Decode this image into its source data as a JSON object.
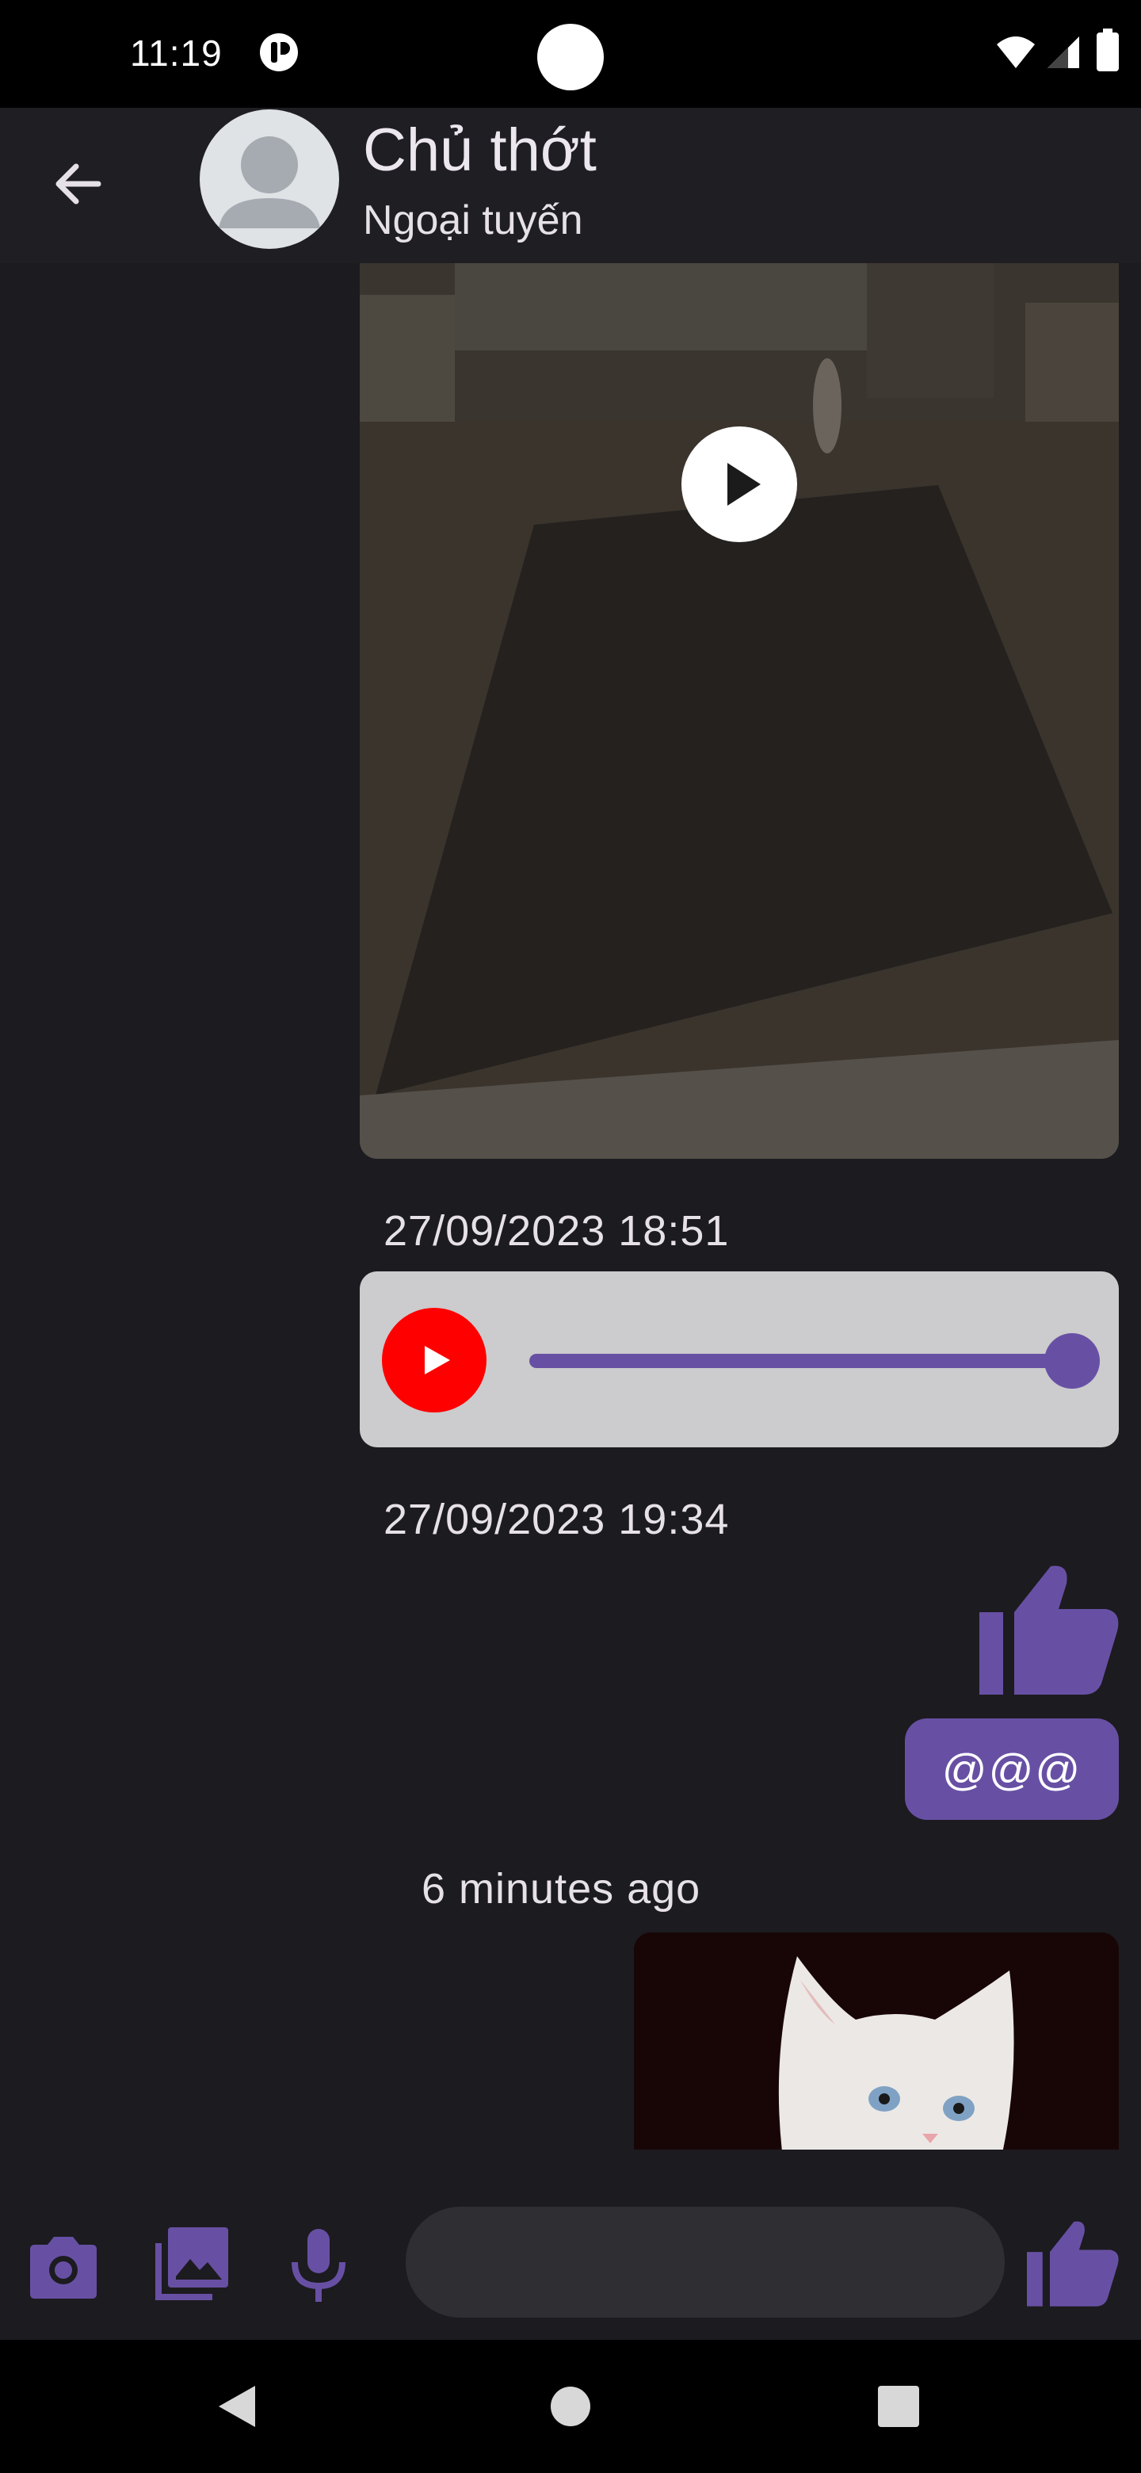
{
  "status_bar": {
    "time": "11:19",
    "icons": [
      "notification-icon",
      "wifi-icon",
      "signal-icon",
      "battery-icon"
    ]
  },
  "header": {
    "contact_name": "Chủ thớt",
    "contact_status": "Ngoại tuyến",
    "back_icon": "arrow-back-icon",
    "avatar_icon": "person-placeholder-icon"
  },
  "messages": [
    {
      "type": "video",
      "icon": "play-icon"
    },
    {
      "type": "timestamp",
      "text": "27/09/2023 18:51"
    },
    {
      "type": "audio",
      "icon": "youtube-play-icon",
      "progress": 1.0
    },
    {
      "type": "timestamp",
      "text": "27/09/2023 19:34"
    },
    {
      "type": "sticker",
      "icon": "thumbs-up-icon"
    },
    {
      "type": "text",
      "text": "@@@"
    },
    {
      "type": "timestamp",
      "text": "6 minutes ago"
    },
    {
      "type": "image",
      "subject": "kitten-photo"
    }
  ],
  "input_bar": {
    "icons": [
      "camera-icon",
      "gallery-icon",
      "mic-icon",
      "thumbs-up-icon"
    ],
    "placeholder": ""
  },
  "nav_bar": {
    "icons": [
      "nav-back-icon",
      "nav-home-icon",
      "nav-recents-icon"
    ]
  },
  "colors": {
    "accent": "#6750a4",
    "background": "#1c1b20",
    "header": "#1f1e23",
    "audio_bubble": "#cccbcd",
    "youtube_red": "#ff0000"
  }
}
